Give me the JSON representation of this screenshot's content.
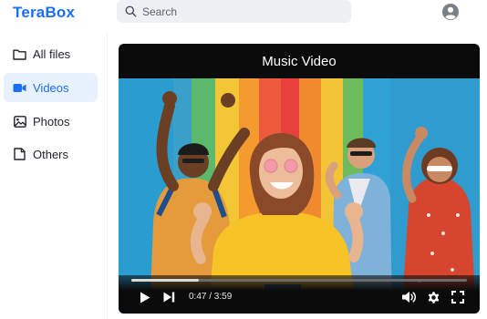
{
  "header": {
    "logo": "TeraBox",
    "search_placeholder": "Search",
    "icons": {
      "search": "search-icon",
      "account": "account-icon"
    },
    "accent_color": "#1a6ff5"
  },
  "sidebar": {
    "items": [
      {
        "label": "All files",
        "icon": "folder-icon",
        "active": false
      },
      {
        "label": "Videos",
        "icon": "video-camera-icon",
        "active": true
      },
      {
        "label": "Photos",
        "icon": "image-icon",
        "active": false
      },
      {
        "label": "Others",
        "icon": "document-icon",
        "active": false
      }
    ]
  },
  "player": {
    "title": "Music Video",
    "current_time": "0:47",
    "duration": "3:59",
    "time_display": "0:47 / 3:59",
    "progress_fraction": 0.2,
    "controls": [
      "play-icon",
      "next-icon",
      "volume-icon",
      "settings-icon",
      "fullscreen-icon"
    ]
  }
}
